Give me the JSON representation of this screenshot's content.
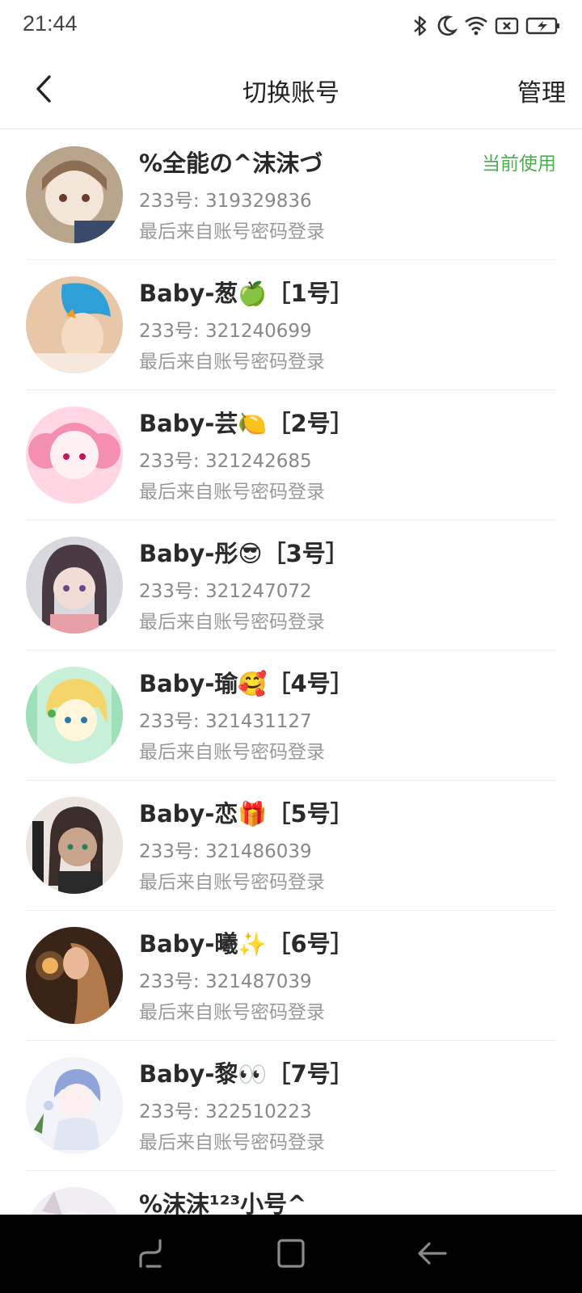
{
  "status_bar": {
    "time": "21:44",
    "icons": [
      "bluetooth-icon",
      "moon-icon",
      "wifi-icon",
      "sim-x-icon",
      "battery-charging-icon"
    ]
  },
  "header": {
    "title": "切换账号",
    "manage_label": "管理",
    "back_icon": "chevron-left-icon"
  },
  "accounts": [
    {
      "name": "%全能の^沫沫づ",
      "id": "233号: 319329836",
      "login": "最后来自账号密码登录",
      "badge": "当前使用",
      "avatar_colors": [
        "#b9a48c",
        "#f3e6d8",
        "#6b5a4a"
      ]
    },
    {
      "name": "Baby-葱🍏［1号］",
      "id": "233号: 321240699",
      "login": "最后来自账号密码登录",
      "badge": "",
      "avatar_colors": [
        "#e8c7a8",
        "#2f9fd8",
        "#f4dcc4"
      ]
    },
    {
      "name": "Baby-芸🍋［2号］",
      "id": "233号: 321242685",
      "login": "最后来自账号密码登录",
      "badge": "",
      "avatar_colors": [
        "#ffd6e2",
        "#f48fb1",
        "#fff0f4"
      ]
    },
    {
      "name": "Baby-彤😎［3号］",
      "id": "233号: 321247072",
      "login": "最后来自账号密码登录",
      "badge": "",
      "avatar_colors": [
        "#d8d8de",
        "#4a3a44",
        "#f2dcd6"
      ]
    },
    {
      "name": "Baby-瑜🥰［4号］",
      "id": "233号: 321431127",
      "login": "最后来自账号密码登录",
      "badge": "",
      "avatar_colors": [
        "#c8f0d8",
        "#f5d56a",
        "#fff6dc"
      ]
    },
    {
      "name": "Baby-恋🎁［5号］",
      "id": "233号: 321486039",
      "login": "最后来自账号密码登录",
      "badge": "",
      "avatar_colors": [
        "#ece4e0",
        "#3b2d2a",
        "#caa58e"
      ]
    },
    {
      "name": "Baby-曦✨［6号］",
      "id": "233号: 321487039",
      "login": "最后来自账号密码登录",
      "badge": "",
      "avatar_colors": [
        "#3a2418",
        "#b07a4a",
        "#f0b060"
      ]
    },
    {
      "name": "Baby-黎👀［7号］",
      "id": "233号: 322510223",
      "login": "最后来自账号密码登录",
      "badge": "",
      "avatar_colors": [
        "#f2f4fa",
        "#8fa4d8",
        "#e0e6f4"
      ]
    },
    {
      "name": "%沫沫¹²³小号^",
      "id": "",
      "login": "",
      "badge": "",
      "avatar_colors": [
        "#f0eef2",
        "#d8ccd8",
        "#f8f4f8"
      ]
    }
  ],
  "nav_bar": {
    "icons": [
      "recents-icon",
      "home-icon",
      "back-icon"
    ]
  }
}
